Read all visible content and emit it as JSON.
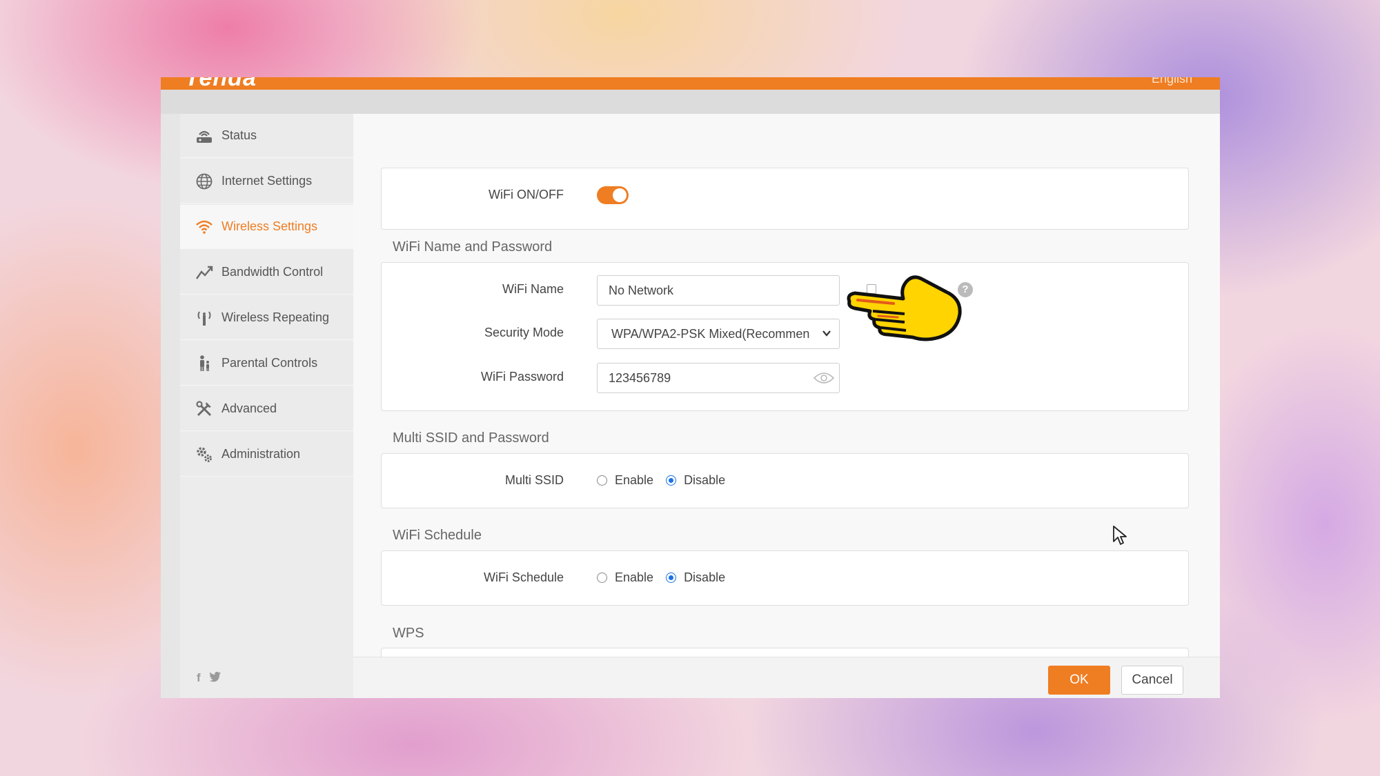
{
  "app": {
    "brand": "Tenda",
    "language": "English",
    "accent_color": "#ef7d22"
  },
  "sidebar": {
    "items": [
      {
        "label": "Status",
        "icon": "router-icon",
        "active": false
      },
      {
        "label": "Internet Settings",
        "icon": "globe-icon",
        "active": false
      },
      {
        "label": "Wireless Settings",
        "icon": "wifi-icon",
        "active": true
      },
      {
        "label": "Bandwidth Control",
        "icon": "chart-line-icon",
        "active": false
      },
      {
        "label": "Wireless Repeating",
        "icon": "antenna-icon",
        "active": false
      },
      {
        "label": "Parental Controls",
        "icon": "parent-child-icon",
        "active": false
      },
      {
        "label": "Advanced",
        "icon": "tools-icon",
        "active": false
      },
      {
        "label": "Administration",
        "icon": "gears-icon",
        "active": false
      }
    ],
    "social": {
      "facebook": "f",
      "twitter": "t"
    }
  },
  "wifi_onoff": {
    "label": "WiFi ON/OFF",
    "enabled": true
  },
  "name_password": {
    "title": "WiFi Name and Password",
    "wifi_name_label": "WiFi Name",
    "wifi_name_value": "No Network",
    "security_label": "Security Mode",
    "security_value": "WPA/WPA2-PSK Mixed(Recommen",
    "password_label": "WiFi Password",
    "password_value": "123456789",
    "help_icon": "?"
  },
  "multi_ssid": {
    "title": "Multi SSID and Password",
    "label": "Multi SSID",
    "options": [
      "Enable",
      "Disable"
    ],
    "selected": "Disable"
  },
  "schedule": {
    "title": "WiFi Schedule",
    "label": "WiFi Schedule",
    "options": [
      "Enable",
      "Disable"
    ],
    "selected": "Disable"
  },
  "wps": {
    "title": "WPS"
  },
  "footer": {
    "ok_label": "OK",
    "cancel_label": "Cancel"
  }
}
